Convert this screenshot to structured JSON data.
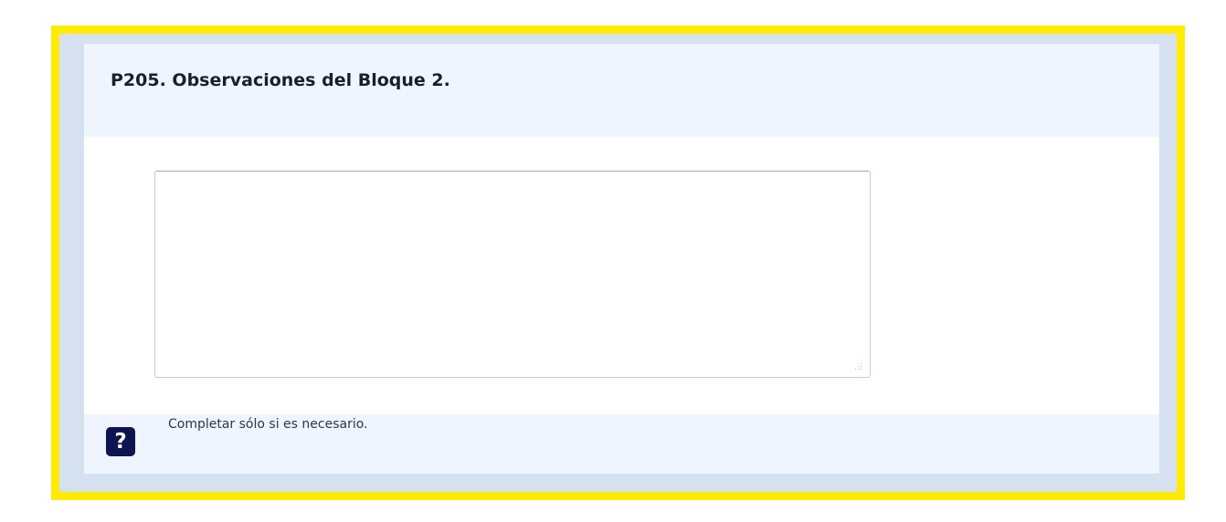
{
  "question": {
    "title": "P205. Observaciones del Bloque 2.",
    "answer_value": "",
    "help_icon_symbol": "?",
    "help_text": "Completar sólo si es necesario."
  },
  "colors": {
    "frame_border": "#ffec00",
    "frame_background": "#d5e0f0",
    "header_background": "#eef5fe",
    "help_icon": "#0e1450"
  }
}
